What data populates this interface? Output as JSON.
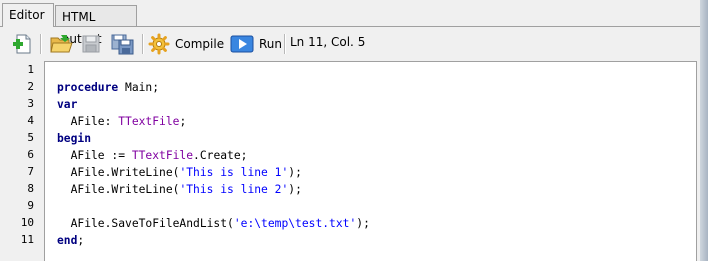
{
  "tabs": [
    {
      "label": "Editor",
      "active": true
    },
    {
      "label": "HTML output",
      "active": false
    }
  ],
  "toolbar": {
    "new_icon": "new-file-icon",
    "open_icon": "open-folder-icon",
    "save_icon": "save-icon",
    "save_all_icon": "save-all-icon",
    "compile_icon": "gear-icon",
    "compile_label": "Compile",
    "run_icon": "play-icon",
    "run_label": "Run",
    "status": "Ln 11, Col. 5"
  },
  "colors": {
    "keyword": "#000080",
    "type": "#8000a0",
    "string": "#0000ff",
    "run_icon": "#2b6fd6",
    "compile_icon": "#e6a21f"
  },
  "editor": {
    "line_numbers": [
      "1",
      "2",
      "3",
      "4",
      "5",
      "6",
      "7",
      "8",
      "9",
      "10",
      "11"
    ],
    "lines": [
      [],
      [
        {
          "t": "procedure",
          "k": "kw"
        },
        {
          "t": " Main;",
          "k": ""
        }
      ],
      [
        {
          "t": "var",
          "k": "kw"
        }
      ],
      [
        {
          "t": "  AFile: ",
          "k": ""
        },
        {
          "t": "TTextFile",
          "k": "ty"
        },
        {
          "t": ";",
          "k": ""
        }
      ],
      [
        {
          "t": "begin",
          "k": "kw"
        }
      ],
      [
        {
          "t": "  AFile := ",
          "k": ""
        },
        {
          "t": "TTextFile",
          "k": "ty"
        },
        {
          "t": ".Create;",
          "k": ""
        }
      ],
      [
        {
          "t": "  AFile.WriteLine(",
          "k": ""
        },
        {
          "t": "'This is line 1'",
          "k": "st"
        },
        {
          "t": ");",
          "k": ""
        }
      ],
      [
        {
          "t": "  AFile.WriteLine(",
          "k": ""
        },
        {
          "t": "'This is line 2'",
          "k": "st"
        },
        {
          "t": ");",
          "k": ""
        }
      ],
      [],
      [
        {
          "t": "  AFile.SaveToFileAndList(",
          "k": ""
        },
        {
          "t": "'e:\\temp\\test.txt'",
          "k": "st"
        },
        {
          "t": ");",
          "k": ""
        }
      ],
      [
        {
          "t": "end",
          "k": "kw"
        },
        {
          "t": ";",
          "k": ""
        }
      ]
    ]
  }
}
